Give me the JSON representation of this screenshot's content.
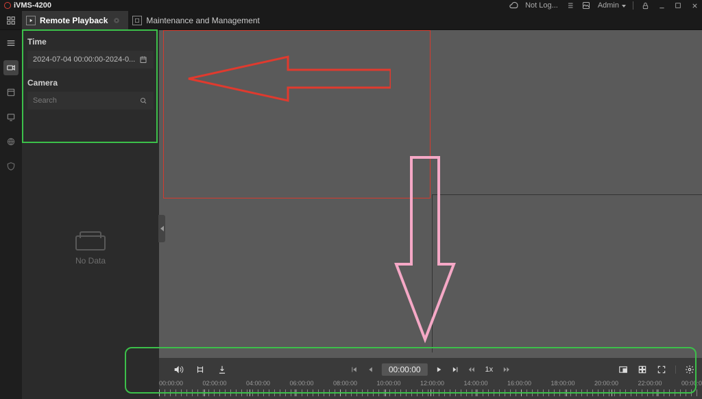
{
  "app": {
    "title": "iVMS-4200"
  },
  "titlebar": {
    "cloud_status": "Not Log...",
    "user": "Admin"
  },
  "tabs": {
    "remote_playback": "Remote Playback",
    "maintenance": "Maintenance and Management"
  },
  "sidebar": {
    "time_heading": "Time",
    "date_range": "2024-07-04 00:00:00-2024-0...",
    "camera_heading": "Camera",
    "search_placeholder": "Search",
    "no_data": "No Data"
  },
  "controls": {
    "current_time": "00:00:00",
    "speed": "1x"
  },
  "timeline": {
    "labels": [
      "00:00:00",
      "02:00:00",
      "04:00:00",
      "06:00:00",
      "08:00:00",
      "10:00:00",
      "12:00:00",
      "14:00:00",
      "16:00:00",
      "18:00:00",
      "20:00:00",
      "22:00:00",
      "00:00:0"
    ]
  }
}
